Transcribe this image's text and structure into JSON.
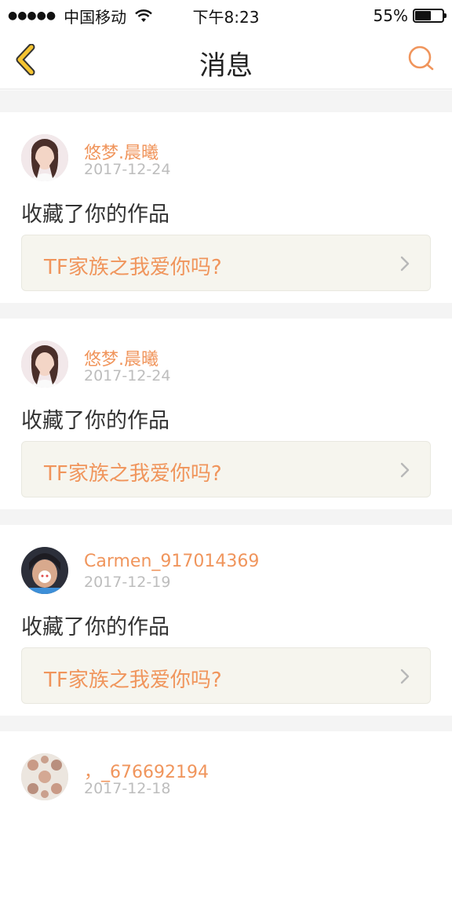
{
  "status_bar": {
    "carrier": "中国移动",
    "time": "下午8:23",
    "battery": "55%"
  },
  "nav": {
    "title": "消息",
    "back_icon": "chevron-left-icon",
    "search_icon": "search-icon"
  },
  "colors": {
    "accent": "#f0955c",
    "back_icon": "#f5c431",
    "text": "#333333",
    "muted": "#bdbdbd"
  },
  "messages": [
    {
      "username": "悠梦.晨曦",
      "date": "2017-12-24",
      "action": "收藏了你的作品",
      "work_title": "TF家族之我爱你吗?"
    },
    {
      "username": "悠梦.晨曦",
      "date": "2017-12-24",
      "action": "收藏了你的作品",
      "work_title": "TF家族之我爱你吗?"
    },
    {
      "username": "Carmen_917014369",
      "date": "2017-12-19",
      "action": "收藏了你的作品",
      "work_title": "TF家族之我爱你吗?"
    },
    {
      "username": "，_676692194",
      "date": "2017-12-18",
      "action": "",
      "work_title": ""
    }
  ]
}
